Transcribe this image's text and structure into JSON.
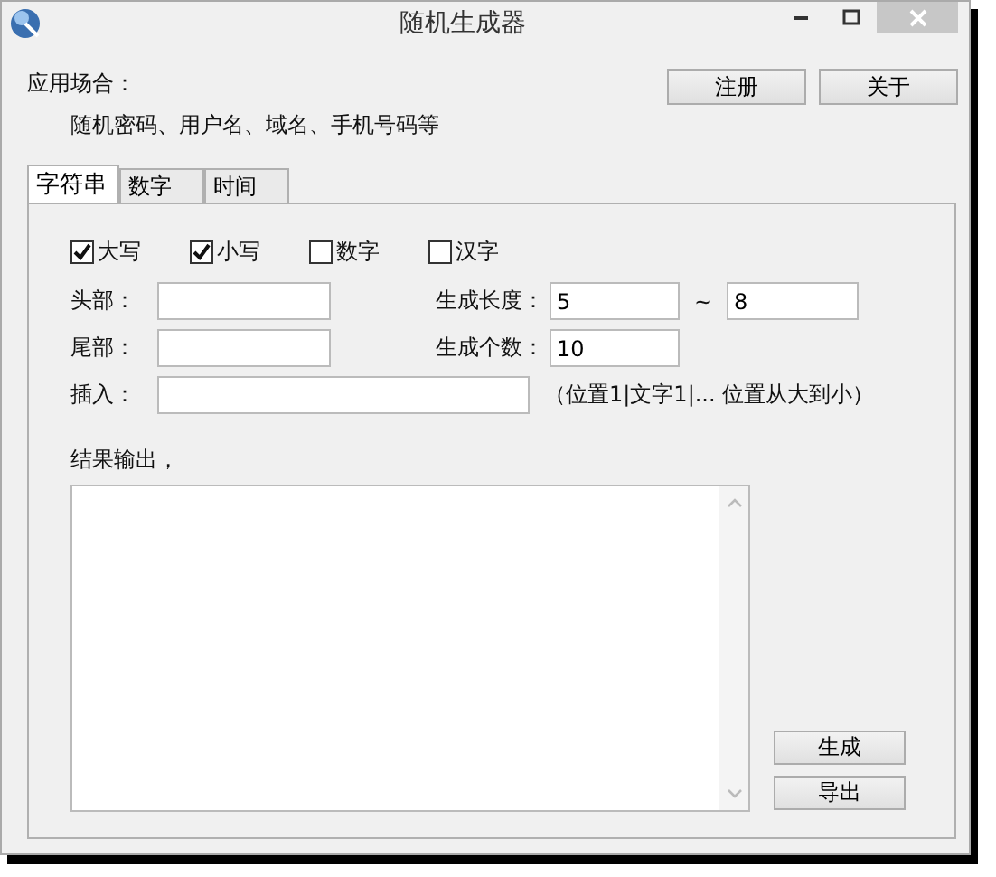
{
  "window": {
    "title": "随机生成器"
  },
  "scene": {
    "label": "应用场合：",
    "description": "随机密码、用户名、域名、手机号码等"
  },
  "header_buttons": [
    "注册",
    "关于"
  ],
  "tabs": [
    {
      "label": "字符串",
      "selected": true
    },
    {
      "label": "数字",
      "selected": false
    },
    {
      "label": "时间",
      "selected": false
    }
  ],
  "options": [
    {
      "label": "大写",
      "checked": true
    },
    {
      "label": "小写",
      "checked": true
    },
    {
      "label": "数字",
      "checked": false
    },
    {
      "label": "汉字",
      "checked": false
    }
  ],
  "head": {
    "label": "头部："
  },
  "tail": {
    "label": "尾部："
  },
  "insert": {
    "label": "插入：",
    "hint": "（位置1|文字1|...  位置从大到小）"
  },
  "length": {
    "label": "生成长度：",
    "min": "5",
    "separator": "~",
    "max": "8"
  },
  "count": {
    "label": "生成个数：",
    "value": "10"
  },
  "output": {
    "label": "结果输出，"
  },
  "action_buttons": [
    "生成",
    "导出"
  ]
}
